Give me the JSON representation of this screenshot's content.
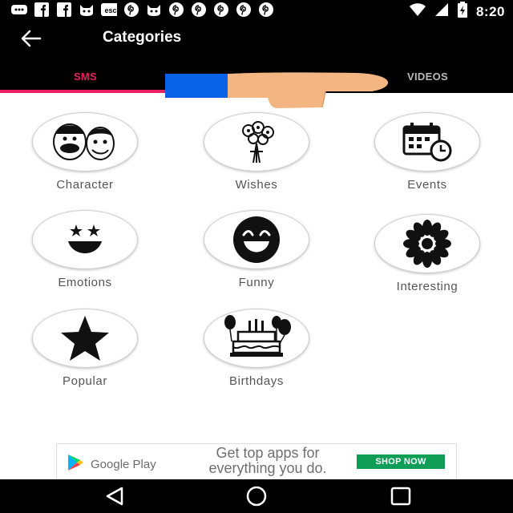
{
  "status_bar": {
    "time": "8:20",
    "left_icons": [
      "messaging-icon",
      "facebook-icon",
      "facebook-icon",
      "cat-app-icon",
      "esc-icon",
      "pinterest-icon",
      "cat-app-icon",
      "pinterest-icon",
      "pinterest-icon",
      "pinterest-icon",
      "pinterest-icon",
      "pinterest-icon"
    ],
    "right_icons": [
      "wifi-icon",
      "signal-icon",
      "battery-charging-icon"
    ]
  },
  "app_bar": {
    "title": "Categories",
    "back_icon": "back-arrow-icon"
  },
  "tabs": [
    {
      "label": "SMS",
      "active": true
    },
    {
      "label": "",
      "active": false
    },
    {
      "label": "VIDEOS",
      "active": false
    }
  ],
  "accent_color": "#e91e63",
  "categories": [
    {
      "label": "Character",
      "icon": "character-faces-icon"
    },
    {
      "label": "Wishes",
      "icon": "flower-bouquet-icon"
    },
    {
      "label": "Events",
      "icon": "calendar-clock-icon"
    },
    {
      "label": "Emotions",
      "icon": "star-eyes-smile-icon"
    },
    {
      "label": "Funny",
      "icon": "laughing-face-icon"
    },
    {
      "label": "Interesting",
      "icon": "sunflower-icon"
    },
    {
      "label": "Popular",
      "icon": "star-icon"
    },
    {
      "label": "Birthdays",
      "icon": "birthday-cake-icon"
    }
  ],
  "ad": {
    "store_name": "Google Play",
    "message": "Get top apps for everything you do.",
    "button": "SHOP NOW"
  },
  "nav_bar": {
    "buttons": [
      "back-triangle-icon",
      "home-circle-icon",
      "recents-square-icon"
    ]
  }
}
